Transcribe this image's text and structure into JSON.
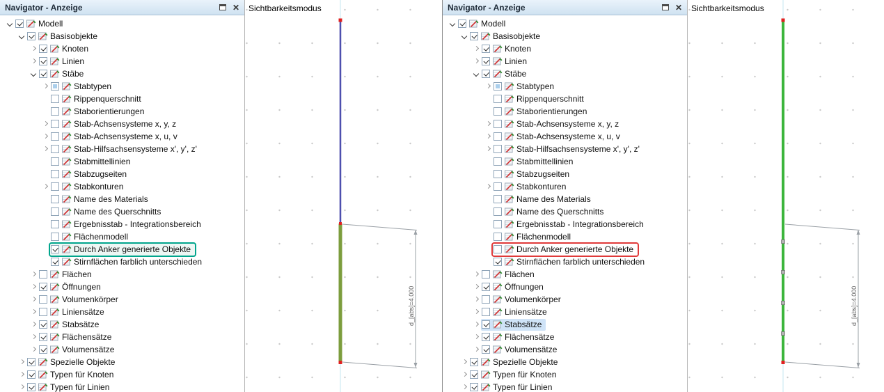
{
  "panels": {
    "left": {
      "title": "Navigator - Anzeige",
      "viewport_label": "Sichtbarkeitsmodus",
      "dimension_label": "d_[abs]=4.000"
    },
    "right": {
      "title": "Navigator - Anzeige",
      "viewport_label": "Sichtbarkeitsmodus",
      "dimension_label": "d_[abs]=4.000"
    }
  },
  "colors": {
    "member_blue": "#4d4fae",
    "member_olive": "#7c9d3d",
    "member_green": "#3cb53c",
    "node_red": "#e02020",
    "marker_gray": "#b5b5b5",
    "axis_cyan": "#c5e7f2",
    "dimension_gray": "#9aa0a6",
    "highlight_teal": "#00a58c",
    "highlight_red": "#e03a3a",
    "selection_blue": "#cfe3f7"
  },
  "tree": {
    "items": [
      {
        "label": "Modell",
        "level": 0,
        "expand": "open",
        "check": "on"
      },
      {
        "label": "Basisobjekte",
        "level": 1,
        "expand": "open",
        "check": "on"
      },
      {
        "label": "Knoten",
        "level": 2,
        "expand": "closed",
        "check": "on"
      },
      {
        "label": "Linien",
        "level": 2,
        "expand": "closed",
        "check": "on"
      },
      {
        "label": "Stäbe",
        "level": 2,
        "expand": "open",
        "check": "on"
      },
      {
        "label": "Stabtypen",
        "level": 3,
        "expand": "closed",
        "check": "partial"
      },
      {
        "label": "Rippenquerschnitt",
        "level": 3,
        "expand": "none",
        "check": "off"
      },
      {
        "label": "Staborientierungen",
        "level": 3,
        "expand": "none",
        "check": "off"
      },
      {
        "label": "Stab-Achsensysteme x, y, z",
        "level": 3,
        "expand": "closed",
        "check": "off"
      },
      {
        "label": "Stab-Achsensysteme x, u, v",
        "level": 3,
        "expand": "closed",
        "check": "off"
      },
      {
        "label": "Stab-Hilfsachsensysteme x', y', z'",
        "level": 3,
        "expand": "closed",
        "check": "off"
      },
      {
        "label": "Stabmittellinien",
        "level": 3,
        "expand": "none",
        "check": "off"
      },
      {
        "label": "Stabzugseiten",
        "level": 3,
        "expand": "none",
        "check": "off"
      },
      {
        "label": "Stabkonturen",
        "level": 3,
        "expand": "closed",
        "check": "off"
      },
      {
        "label": "Name des Materials",
        "level": 3,
        "expand": "none",
        "check": "off"
      },
      {
        "label": "Name des Querschnitts",
        "level": 3,
        "expand": "none",
        "check": "off"
      },
      {
        "label": "Ergebnisstab - Integrationsbereich",
        "level": 3,
        "expand": "none",
        "check": "off"
      },
      {
        "label": "Flächenmodell",
        "level": 3,
        "expand": "none",
        "check": "off"
      },
      {
        "label": "Durch Anker generierte Objekte",
        "level": 3,
        "expand": "none",
        "check": {
          "left": "on",
          "right": "off"
        },
        "highlight": {
          "left": "teal",
          "right": "red"
        }
      },
      {
        "label": "Stirnflächen farblich unterschieden",
        "level": 3,
        "expand": "none",
        "check": "on"
      },
      {
        "label": "Flächen",
        "level": 2,
        "expand": "closed",
        "check": "off"
      },
      {
        "label": "Öffnungen",
        "level": 2,
        "expand": "closed",
        "check": "on"
      },
      {
        "label": "Volumenkörper",
        "level": 2,
        "expand": "closed",
        "check": "off"
      },
      {
        "label": "Liniensätze",
        "level": 2,
        "expand": "closed",
        "check": "off"
      },
      {
        "label": "Stabsätze",
        "level": 2,
        "expand": "closed",
        "check": "on",
        "highlight": {
          "left": null,
          "right": "selected"
        }
      },
      {
        "label": "Flächensätze",
        "level": 2,
        "expand": "closed",
        "check": "on"
      },
      {
        "label": "Volumensätze",
        "level": 2,
        "expand": "closed",
        "check": "on"
      },
      {
        "label": "Spezielle Objekte",
        "level": 1,
        "expand": "closed",
        "check": "on"
      },
      {
        "label": "Typen für Knoten",
        "level": 1,
        "expand": "closed",
        "check": "on"
      },
      {
        "label": "Typen für Linien",
        "level": 1,
        "expand": "closed",
        "check": "on"
      }
    ]
  }
}
